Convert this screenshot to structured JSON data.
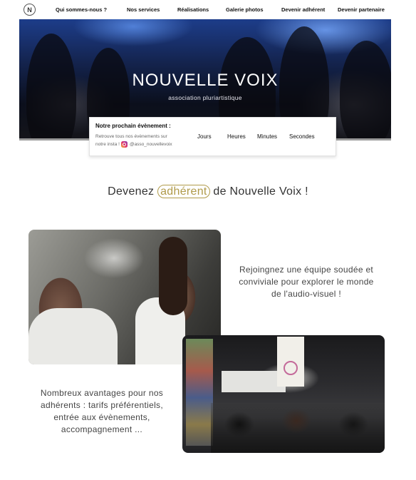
{
  "nav": {
    "logo": "N",
    "items": [
      {
        "label": "Qui sommes-nous ?"
      },
      {
        "label": "Nos services"
      },
      {
        "label": "Réalisations"
      },
      {
        "label": "Galerie photos"
      },
      {
        "label": "Devenir adhérent"
      },
      {
        "label": "Devenir partenaire"
      }
    ]
  },
  "hero": {
    "title": "NOUVELLE VOIX",
    "subtitle": "association pluriartistique"
  },
  "event_card": {
    "title": "Notre prochain évènement :",
    "line1": "Retrouve tous nos évènements sur",
    "line2_prefix": "notre insta !",
    "instagram_handle": "@asso_nouvellevoix",
    "labels": {
      "days": "Jours",
      "hours": "Heures",
      "minutes": "Minutes",
      "seconds": "Secondes"
    }
  },
  "heading": {
    "before": "Devenez ",
    "highlight": "adhérent",
    "after": " de Nouvelle Voix !"
  },
  "block1": {
    "text": "Rejoingnez une équipe soudée et conviviale pour explorer le monde de l'audio-visuel !"
  },
  "block2": {
    "text": "Nombreux avantages pour nos adhérents : tarifs préférentiels, entrée aux évènements, accompagnement ..."
  },
  "colors": {
    "accent": "#b09a4a",
    "text": "#444444",
    "hero_blue": "#1d3d8a"
  }
}
